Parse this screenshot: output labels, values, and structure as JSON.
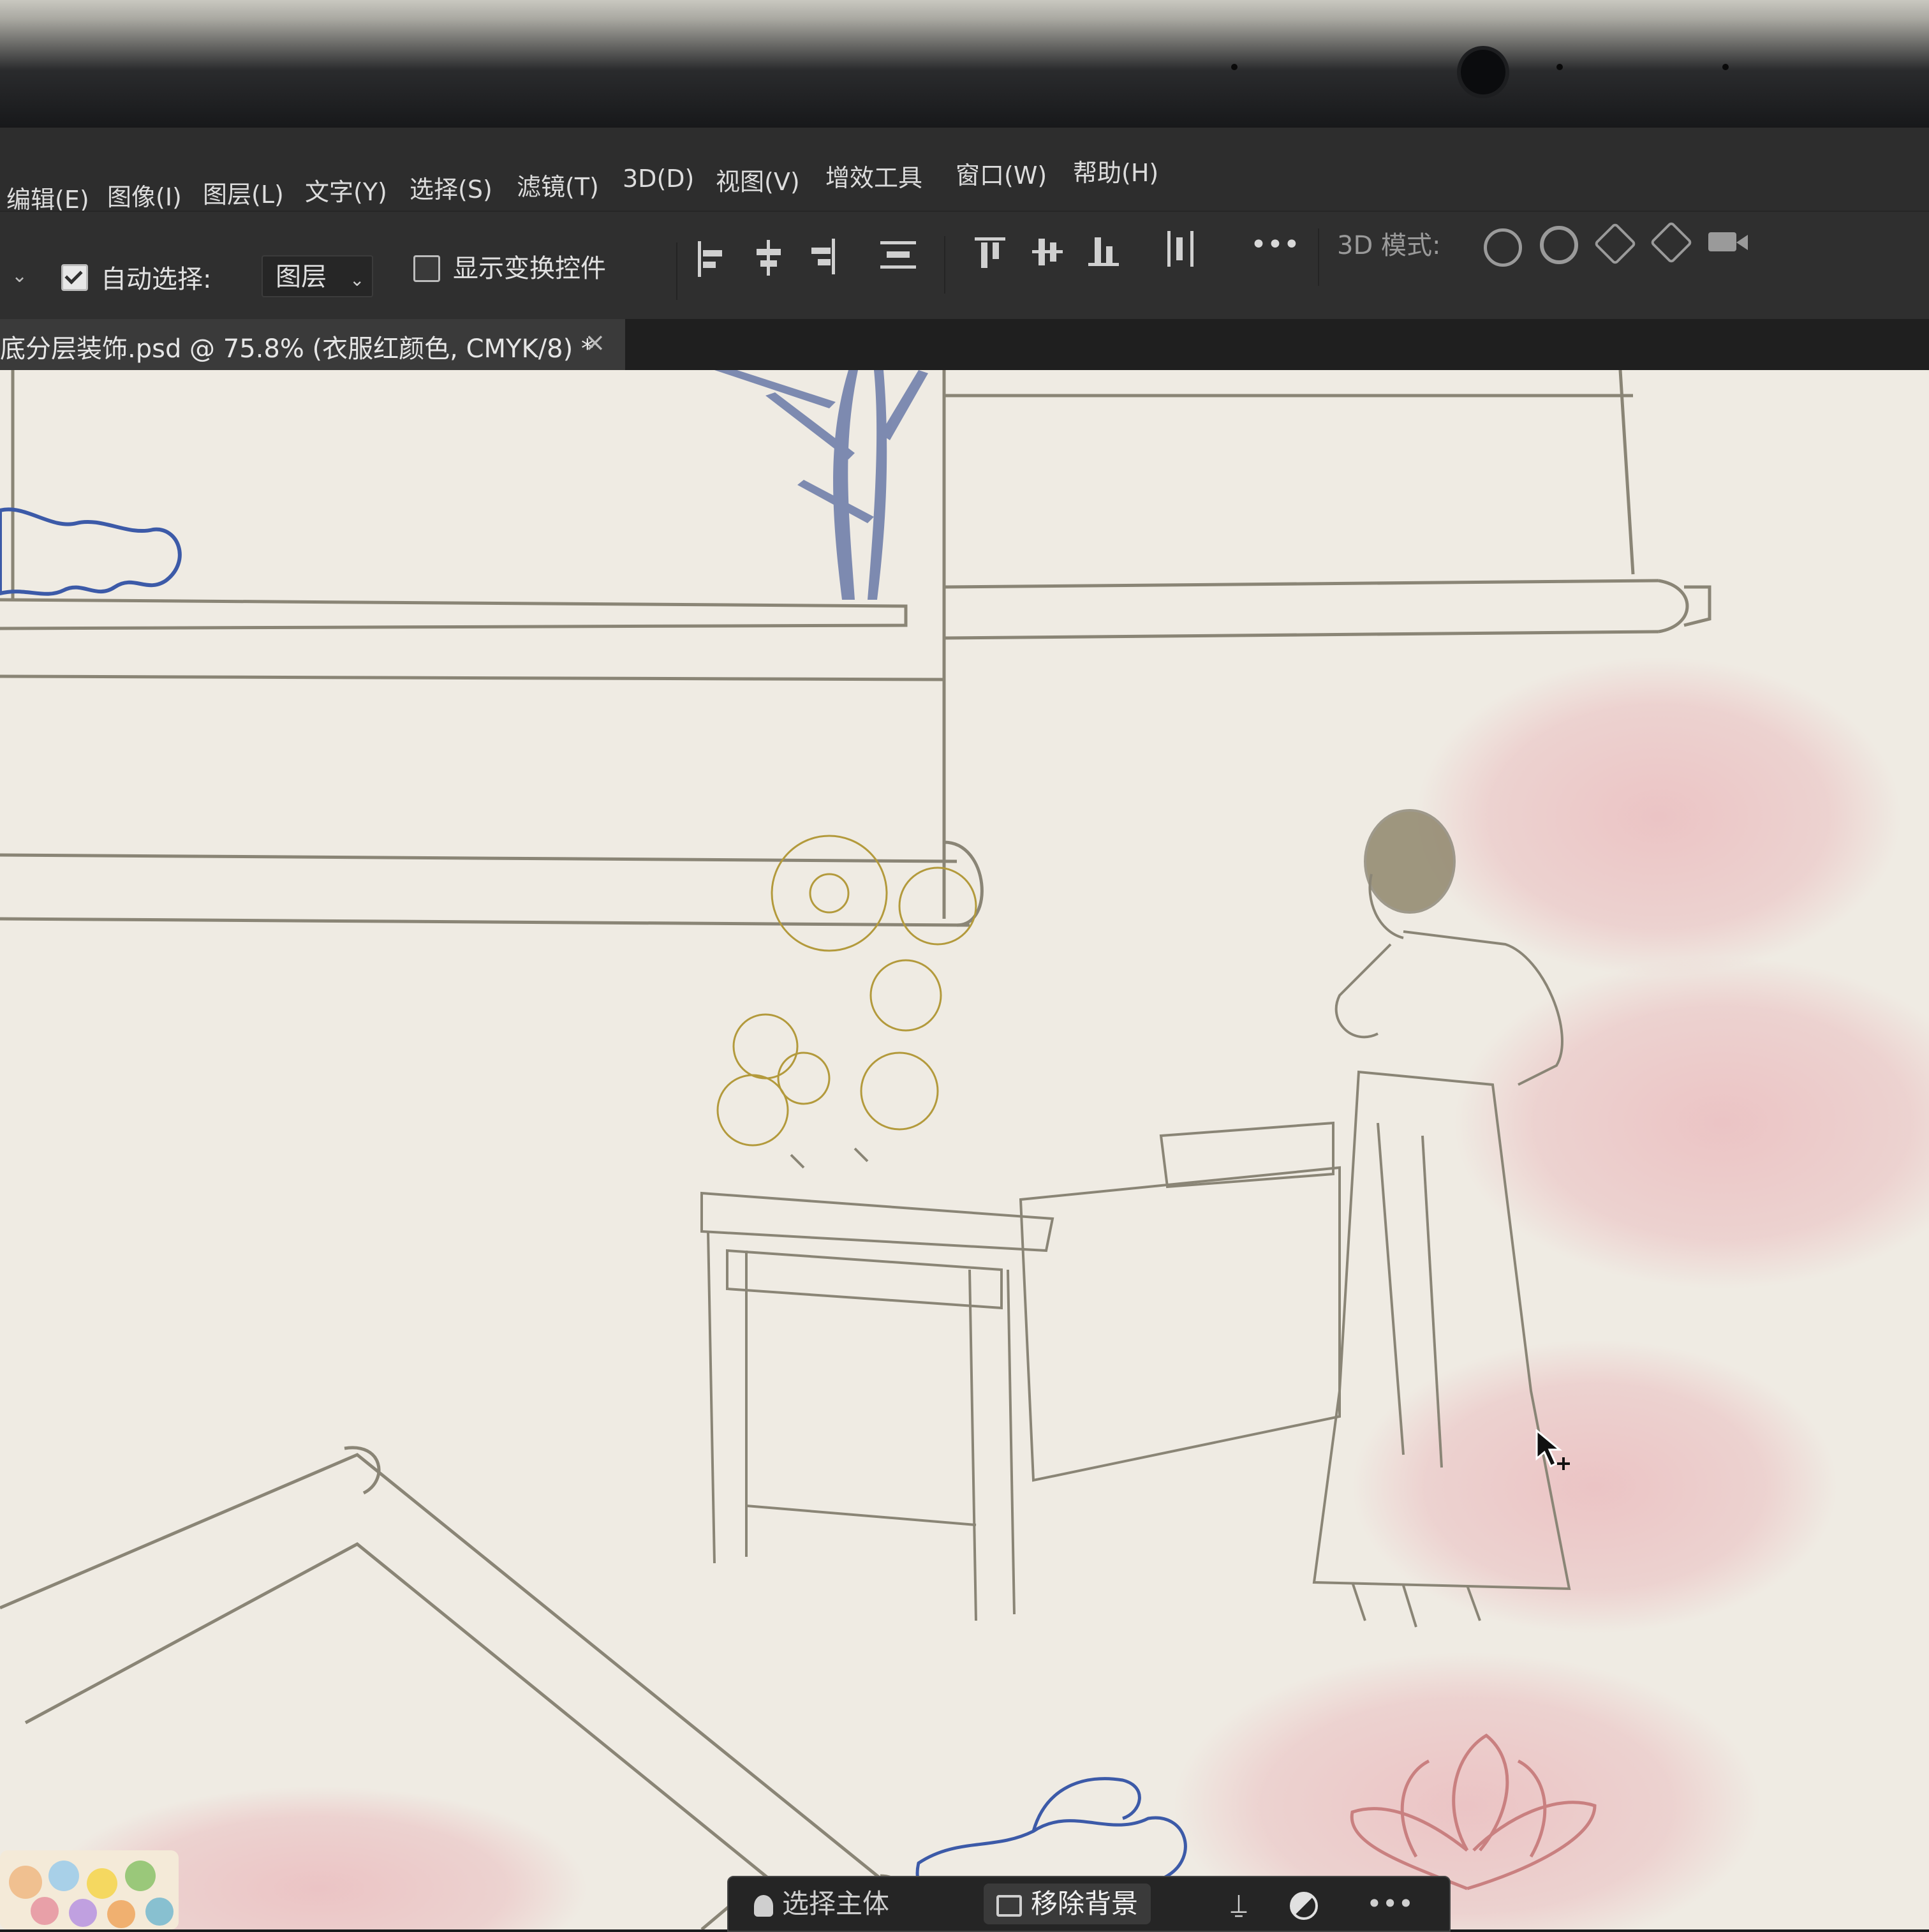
{
  "menu": {
    "items": [
      "编辑(E)",
      "图像(I)",
      "图层(L)",
      "文字(Y)",
      "选择(S)",
      "滤镜(T)",
      "3D(D)",
      "视图(V)",
      "增效工具",
      "窗口(W)",
      "帮助(H)"
    ]
  },
  "options": {
    "auto_select_label": "自动选择:",
    "auto_select_checked": true,
    "layer_target": "图层",
    "show_transform_label": "显示变换控件",
    "show_transform_checked": false,
    "more_label": "•••",
    "mode3d_label": "3D 模式:"
  },
  "document": {
    "tab_title": "底分层装饰.psd @ 75.8% (衣服红颜色, CMYK/8) *",
    "close_glyph": "×"
  },
  "task_bar": {
    "select_subject": "选择主体",
    "remove_background": "移除背景",
    "more": "•••"
  },
  "colors": {
    "canvas_paper": "#efebe3",
    "line_art": "#8a8576",
    "blue_rock": "#3c5aa8",
    "gold_flower": "#b39a3c",
    "pink_wash": "#e8a4ac",
    "lotus": "#c98080",
    "bamboo": "#6a7aa8"
  },
  "icons": [
    "move-tool-chevron",
    "align-left-icon",
    "align-hcenter-icon",
    "align-right-icon",
    "distribute-icon",
    "align-top-icon",
    "align-vcenter-icon",
    "align-bottom-icon",
    "distribute-h-icon",
    "orbit-3d-icon",
    "roll-3d-icon",
    "pan-3d-icon",
    "slide-3d-icon",
    "camera-3d-icon"
  ]
}
